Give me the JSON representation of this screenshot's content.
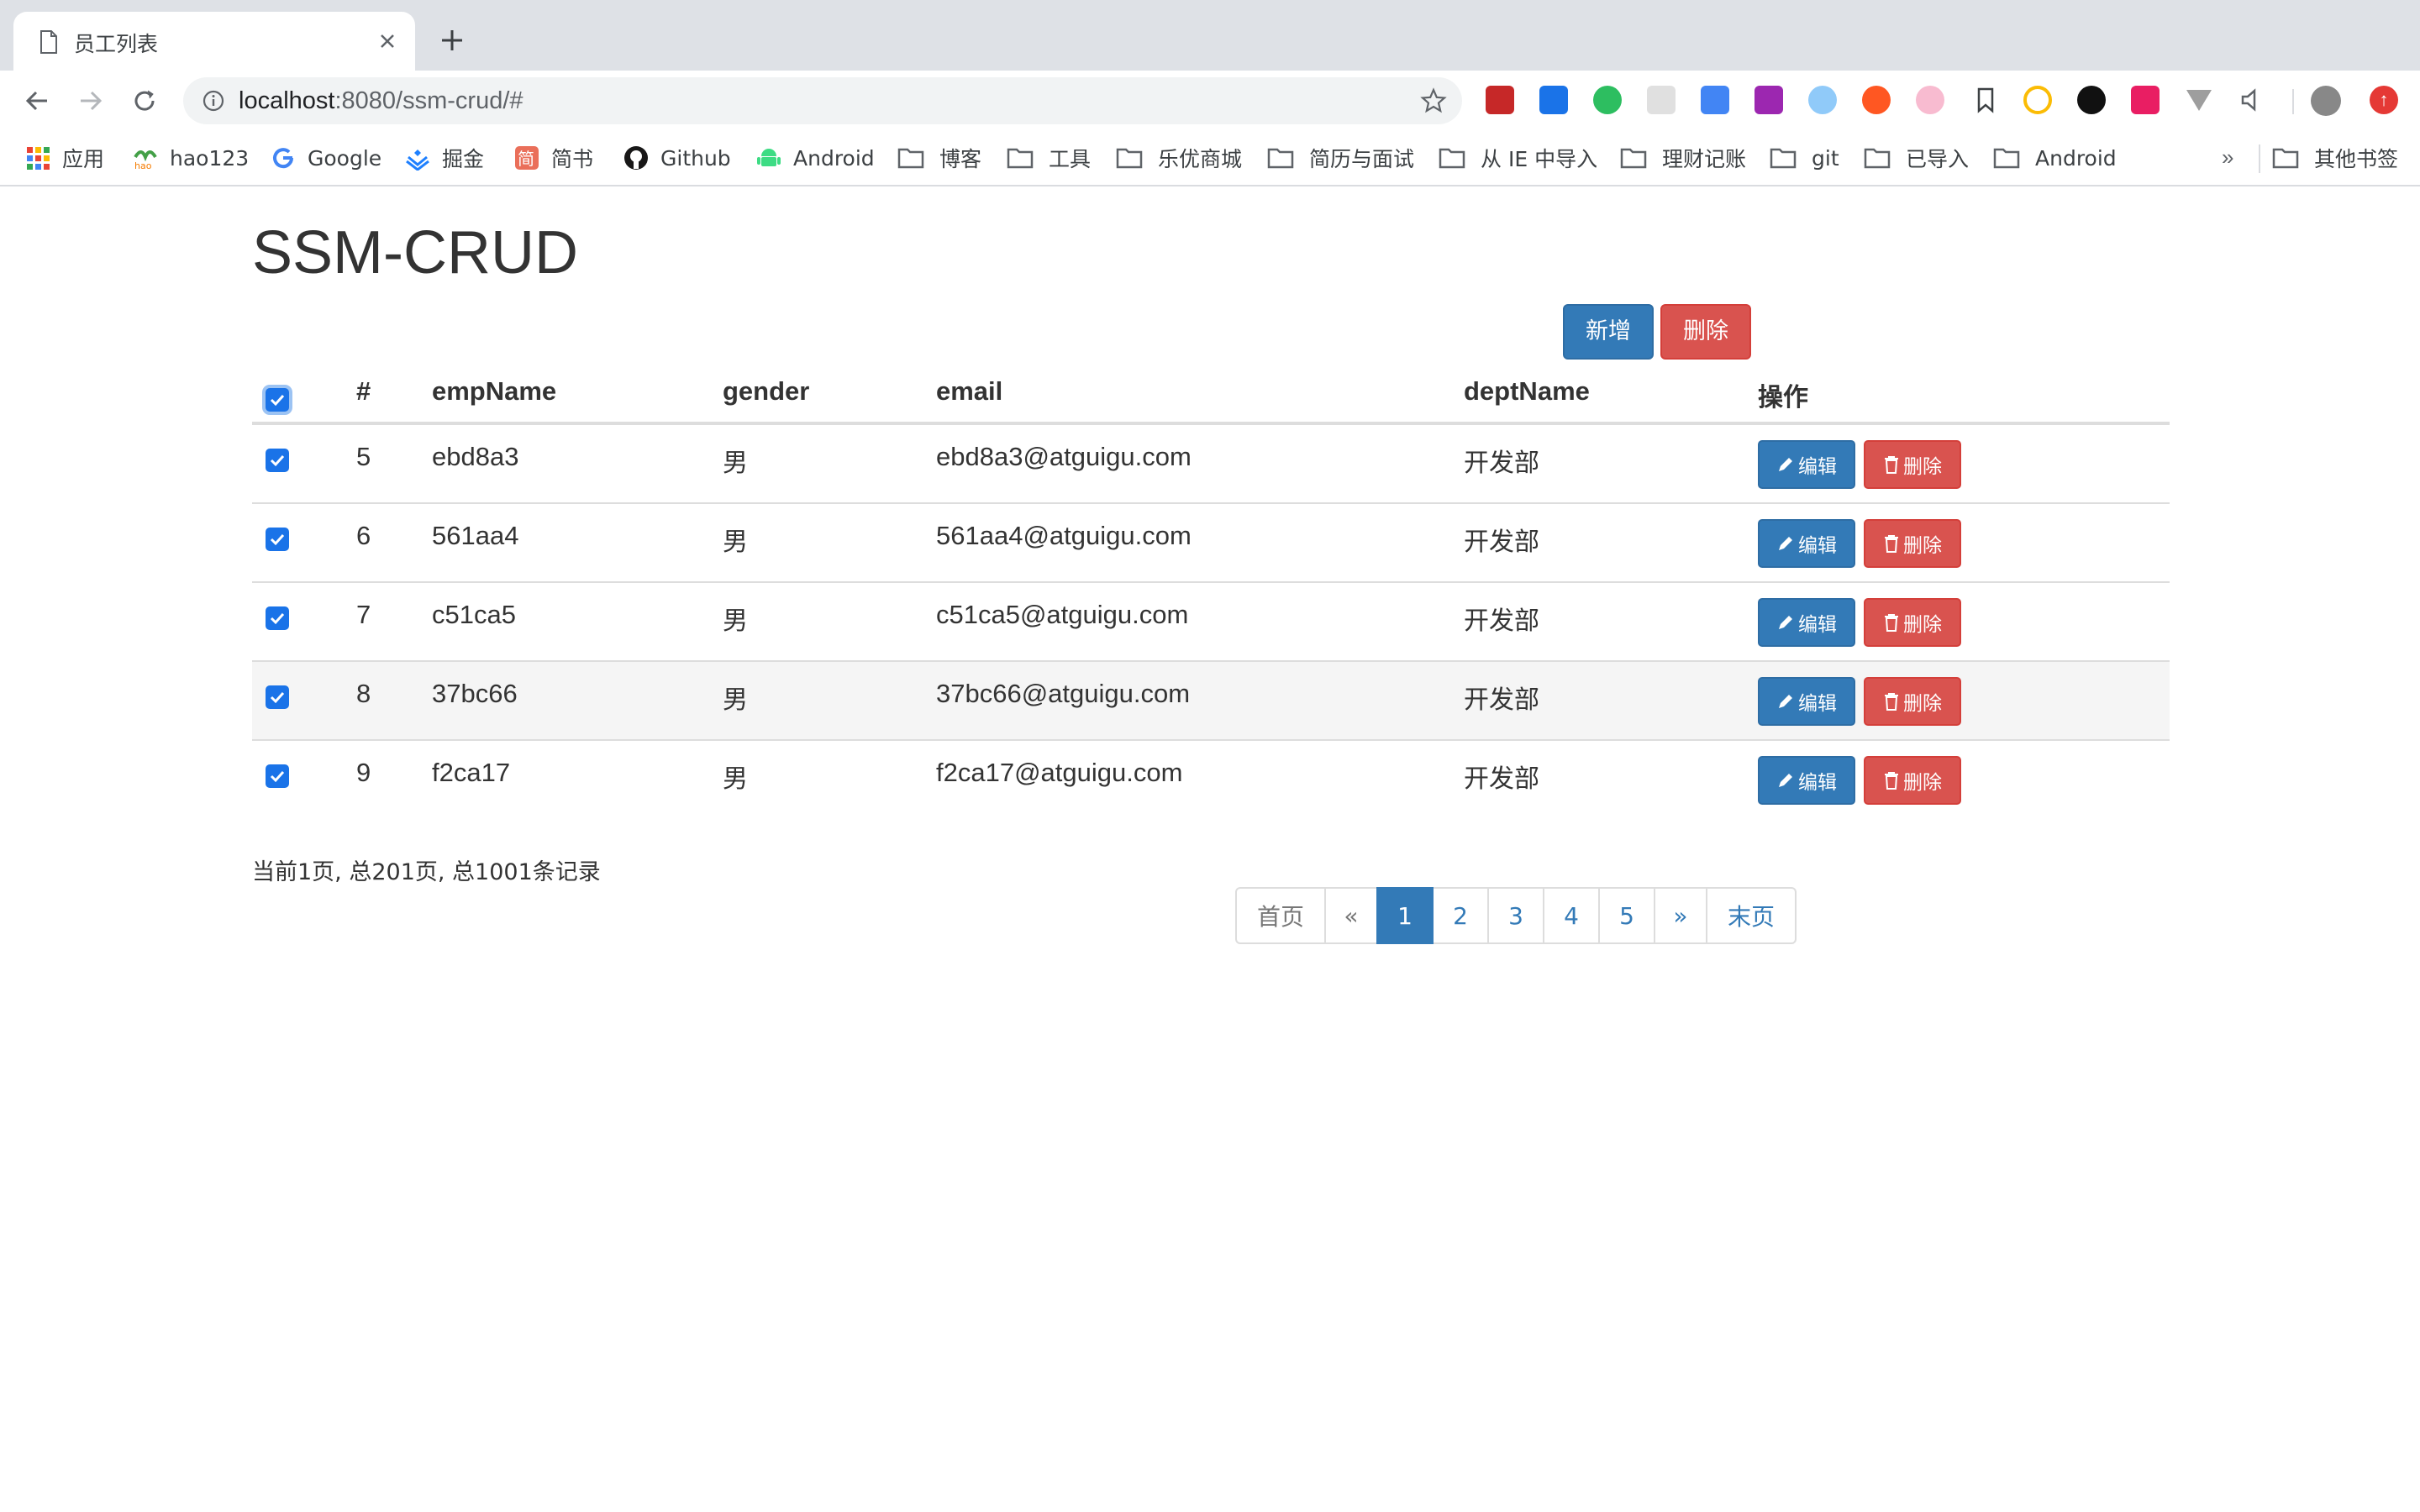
{
  "browser": {
    "tab_title": "员工列表",
    "url_host": "localhost",
    "url_rest": ":8080/ssm-crud/#",
    "bookmarks": [
      {
        "label": "应用",
        "icon": "apps-grid-icon"
      },
      {
        "label": "hao123",
        "icon": "hao123-icon"
      },
      {
        "label": "Google",
        "icon": "google-icon"
      },
      {
        "label": "掘金",
        "icon": "juejin-icon"
      },
      {
        "label": "简书",
        "icon": "jianshu-icon"
      },
      {
        "label": "Github",
        "icon": "github-icon"
      },
      {
        "label": "Android",
        "icon": "android-icon"
      },
      {
        "label": "博客",
        "icon": "folder-icon"
      },
      {
        "label": "工具",
        "icon": "folder-icon"
      },
      {
        "label": "乐优商城",
        "icon": "folder-icon"
      },
      {
        "label": "简历与面试",
        "icon": "folder-icon"
      },
      {
        "label": "从 IE 中导入",
        "icon": "folder-icon"
      },
      {
        "label": "理财记账",
        "icon": "folder-icon"
      },
      {
        "label": "git",
        "icon": "folder-icon"
      },
      {
        "label": "已导入",
        "icon": "folder-icon"
      },
      {
        "label": "Android",
        "icon": "folder-icon"
      }
    ],
    "more_bookmarks": "»",
    "other_bookmarks": "其他书签"
  },
  "page": {
    "title": "SSM-CRUD",
    "add_button": "新增",
    "delete_all_button": "删除"
  },
  "table": {
    "headers": [
      "#",
      "empName",
      "gender",
      "email",
      "deptName",
      "操作"
    ],
    "rows": [
      {
        "id": "5",
        "empName": "ebd8a3",
        "gender": "男",
        "email": "ebd8a3@atguigu.com",
        "deptName": "开发部",
        "checked": true
      },
      {
        "id": "6",
        "empName": "561aa4",
        "gender": "男",
        "email": "561aa4@atguigu.com",
        "deptName": "开发部",
        "checked": true
      },
      {
        "id": "7",
        "empName": "c51ca5",
        "gender": "男",
        "email": "c51ca5@atguigu.com",
        "deptName": "开发部",
        "checked": true
      },
      {
        "id": "8",
        "empName": "37bc66",
        "gender": "男",
        "email": "37bc66@atguigu.com",
        "deptName": "开发部",
        "checked": true
      },
      {
        "id": "9",
        "empName": "f2ca17",
        "gender": "男",
        "email": "f2ca17@atguigu.com",
        "deptName": "开发部",
        "checked": true
      }
    ],
    "edit_label": "编辑",
    "delete_label": "删除"
  },
  "pagination": {
    "info": "当前1页, 总201页, 总1001条记录",
    "first": "首页",
    "prev": "«",
    "pages": [
      "1",
      "2",
      "3",
      "4",
      "5"
    ],
    "active_page": "1",
    "next": "»",
    "last": "末页"
  },
  "colors": {
    "primary": "#337ab7",
    "danger": "#d9534f",
    "checkbox": "#1a73e8"
  }
}
